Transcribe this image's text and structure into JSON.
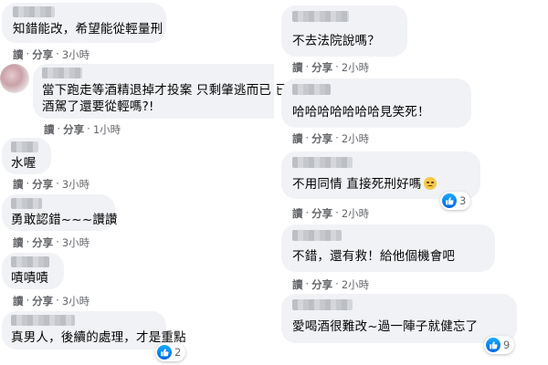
{
  "action_reply": "讀",
  "action_share": "分享",
  "sep": "·",
  "colors": {
    "bubble": "#f0f2f5",
    "meta": "#65676b",
    "like_blue": "#0866ff"
  },
  "left": [
    {
      "text": "知錯能改，希望能從輕量刑",
      "time": "3小時"
    },
    {
      "text1": "當下跑走等酒精退掉才投案 只剩肇逃而已 已",
      "text2": "酒駕了還要從輕嗎?!",
      "time": "1小時"
    },
    {
      "text": "水喔",
      "time": "3小時"
    },
    {
      "text": "勇敢認錯~~~讚讚",
      "time": "3小時"
    },
    {
      "text": "嘖嘖嘖",
      "time": "3小時"
    },
    {
      "text": "真男人，後續的處理，才是重點",
      "time": "",
      "reactions": "2"
    }
  ],
  "right": [
    {
      "text": "不去法院說嗎？",
      "time": "2小時"
    },
    {
      "text": "哈哈哈哈哈哈哈見笑死！",
      "time": "2小時"
    },
    {
      "text": "不用同情 直接死刑好嗎",
      "emoji": "worried-face-icon",
      "time": "2小時",
      "reactions": "3"
    },
    {
      "text": "不錯，還有救！給他個機會吧",
      "time": "2小時"
    },
    {
      "text": "愛喝酒很難改~過一陣子就健忘了",
      "time": "",
      "reactions": "9"
    }
  ]
}
